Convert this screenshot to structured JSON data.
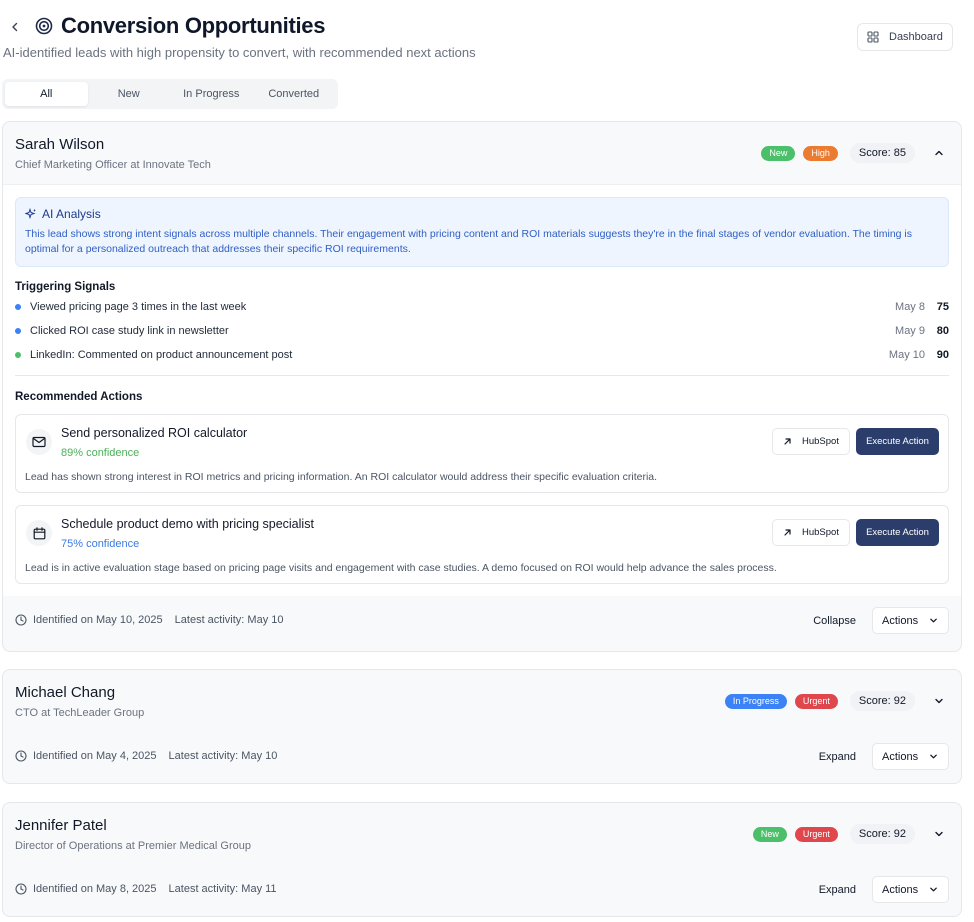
{
  "header": {
    "title": "Conversion Opportunities",
    "subtitle": "AI-identified leads with high propensity to convert, with recommended next actions",
    "dashboard_label": "Dashboard"
  },
  "tabs": [
    {
      "label": "All",
      "active": true
    },
    {
      "label": "New",
      "active": false
    },
    {
      "label": "In Progress",
      "active": false
    },
    {
      "label": "Converted",
      "active": false
    }
  ],
  "colors": {
    "new": "#4cbf6b",
    "high": "#ec7b32",
    "in_progress": "#3b82f6",
    "urgent": "#e0474c",
    "confidence_green": "#4caf5a",
    "confidence_blue": "#3b7be0",
    "execute": "#2b3e6b"
  },
  "leads": [
    {
      "name": "Sarah Wilson",
      "role": "Chief Marketing Officer at Innovate Tech",
      "status": "New",
      "priority": "High",
      "score": "Score: 85",
      "expanded": true,
      "ai_title": "AI Analysis",
      "ai_text": "This lead shows strong intent signals across multiple channels. Their engagement with pricing content and ROI materials suggests they're in the final stages of vendor evaluation. The timing is optimal for a personalized outreach that addresses their specific ROI requirements.",
      "signals_title": "Triggering Signals",
      "signals": [
        {
          "text": "Viewed pricing page 3 times in the last week",
          "date": "May 8",
          "value": "75",
          "dot": "#3b82f6"
        },
        {
          "text": "Clicked ROI case study link in newsletter",
          "date": "May 9",
          "value": "80",
          "dot": "#3b82f6"
        },
        {
          "text": "LinkedIn: Commented on product announcement post",
          "date": "May 10",
          "value": "90",
          "dot": "#4cbf6b"
        }
      ],
      "actions_title": "Recommended Actions",
      "actions": [
        {
          "icon": "mail-icon",
          "title": "Send personalized ROI calculator",
          "confidence": "89% confidence",
          "description": "Lead has shown strong interest in ROI metrics and pricing information. An ROI calculator would address their specific evaluation criteria.",
          "hub_label": "HubSpot",
          "exec_label": "Execute Action"
        },
        {
          "icon": "calendar-icon",
          "title": "Schedule product demo with pricing specialist",
          "confidence": "75% confidence",
          "description": "Lead is in active evaluation stage based on pricing page visits and engagement with case studies. A demo focused on ROI would help advance the sales process.",
          "hub_label": "HubSpot",
          "exec_label": "Execute Action"
        }
      ],
      "identified": "Identified on May 10, 2025",
      "latest": "Latest activity: May 10",
      "toggle": "Collapse",
      "actions_label": "Actions"
    },
    {
      "name": "Michael Chang",
      "role": "CTO at TechLeader Group",
      "status": "In Progress",
      "priority": "Urgent",
      "score": "Score: 92",
      "expanded": false,
      "identified": "Identified on May 4, 2025",
      "latest": "Latest activity: May 10",
      "toggle": "Expand",
      "actions_label": "Actions"
    },
    {
      "name": "Jennifer Patel",
      "role": "Director of Operations at Premier Medical Group",
      "status": "New",
      "priority": "Urgent",
      "score": "Score: 92",
      "expanded": false,
      "identified": "Identified on May 8, 2025",
      "latest": "Latest activity: May 11",
      "toggle": "Expand",
      "actions_label": "Actions"
    }
  ]
}
